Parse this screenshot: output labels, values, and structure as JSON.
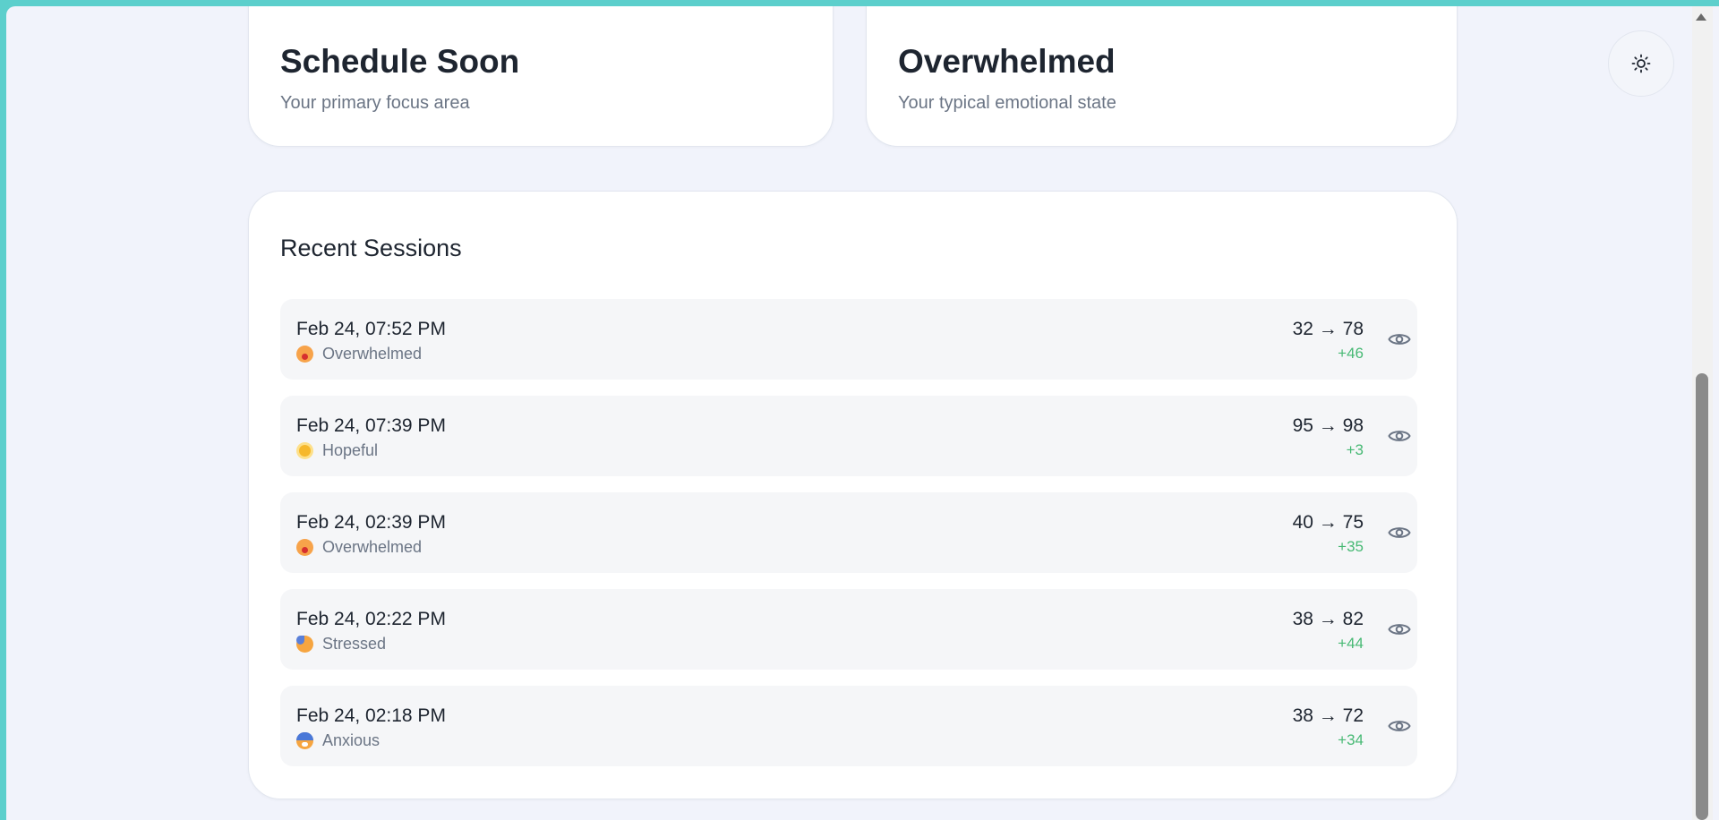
{
  "focus_card": {
    "title": "Schedule Soon",
    "subtitle": "Your primary focus area"
  },
  "emotion_card": {
    "title": "Overwhelmed",
    "subtitle": "Your typical emotional state"
  },
  "sessions": {
    "title": "Recent Sessions",
    "items": [
      {
        "date": "Feb 24, 07:52 PM",
        "mood": "Overwhelmed",
        "mood_icon": "overwhelmed-emoji",
        "score": "32 → 78",
        "delta": "+46"
      },
      {
        "date": "Feb 24, 07:39 PM",
        "mood": "Hopeful",
        "mood_icon": "sun-emoji",
        "score": "95 → 98",
        "delta": "+3"
      },
      {
        "date": "Feb 24, 02:39 PM",
        "mood": "Overwhelmed",
        "mood_icon": "overwhelmed-emoji",
        "score": "40 → 75",
        "delta": "+35"
      },
      {
        "date": "Feb 24, 02:22 PM",
        "mood": "Stressed",
        "mood_icon": "stressed-emoji",
        "score": "38 → 82",
        "delta": "+44"
      },
      {
        "date": "Feb 24, 02:18 PM",
        "mood": "Anxious",
        "mood_icon": "anxious-emoji",
        "score": "38 → 72",
        "delta": "+34"
      }
    ]
  },
  "theme_toggle": {
    "icon": "sun-icon"
  },
  "colors": {
    "accent_positive": "#47b974",
    "window_frame": "#5ccfcc",
    "page_background": "#f1f3fb"
  }
}
